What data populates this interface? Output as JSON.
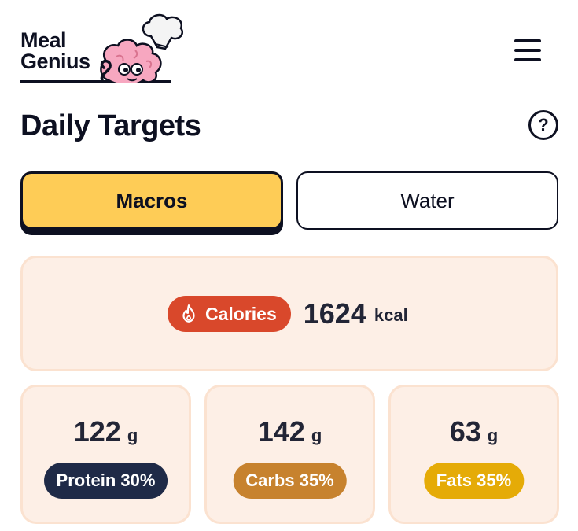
{
  "header": {
    "logo_line1": "Meal",
    "logo_line2": "Genius",
    "menu_icon": "hamburger-menu-icon"
  },
  "page": {
    "title": "Daily Targets",
    "help_glyph": "?",
    "help_icon": "help-circle-icon"
  },
  "tabs": [
    {
      "label": "Macros",
      "active": true
    },
    {
      "label": "Water",
      "active": false
    }
  ],
  "calories": {
    "label": "Calories",
    "icon": "flame-icon",
    "value": "1624",
    "unit": "kcal"
  },
  "macros": [
    {
      "value": "122",
      "unit": "g",
      "label": "Protein 30%",
      "color": "#1f2a47"
    },
    {
      "value": "142",
      "unit": "g",
      "label": "Carbs 35%",
      "color": "#c7822e"
    },
    {
      "value": "63",
      "unit": "g",
      "label": "Fats 35%",
      "color": "#e5ab07"
    }
  ],
  "colors": {
    "accent_yellow": "#fecc56",
    "calories_red": "#d9482b",
    "card_bg": "#fdefe6",
    "text_dark": "#0d1021"
  }
}
